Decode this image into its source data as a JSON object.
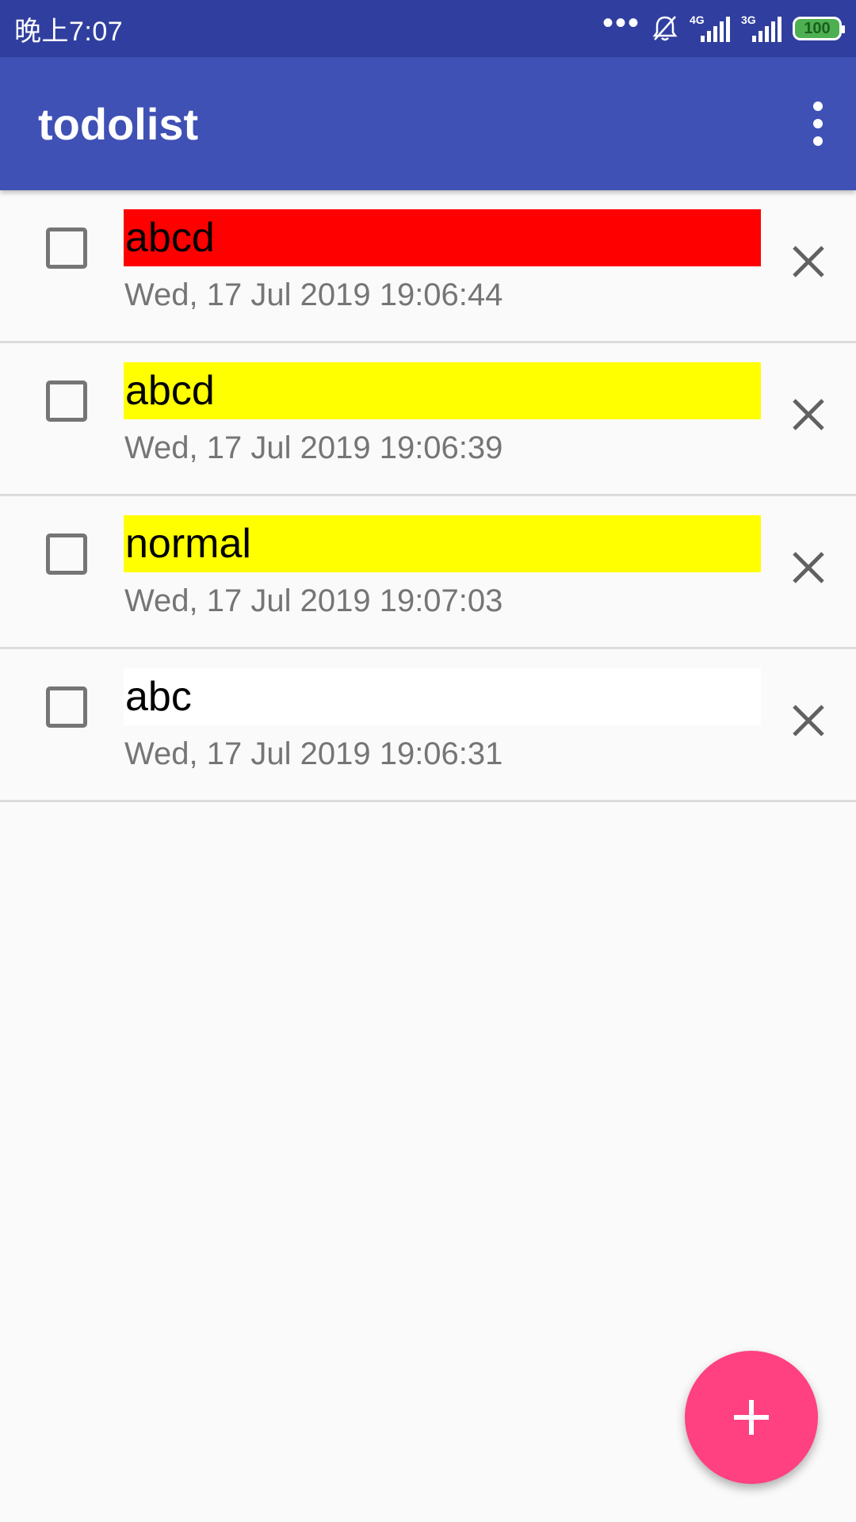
{
  "status_bar": {
    "time": "晚上7:07",
    "signal1_label": "4G",
    "signal2_label": "3G",
    "battery": "100",
    "icons": [
      "more-dots-icon",
      "bell-off-icon",
      "signal-icon",
      "battery-icon"
    ]
  },
  "app_bar": {
    "title": "todolist",
    "overflow_icon": "more-vert-icon"
  },
  "todos": [
    {
      "title": "abcd",
      "date": "Wed, 17 Jul 2019 19:06:44",
      "color": "#ff0000",
      "checked": false
    },
    {
      "title": "abcd",
      "date": "Wed, 17 Jul 2019 19:06:39",
      "color": "#ffff00",
      "checked": false
    },
    {
      "title": "normal",
      "date": "Wed, 17 Jul 2019 19:07:03",
      "color": "#ffff00",
      "checked": false
    },
    {
      "title": "abc",
      "date": "Wed, 17 Jul 2019 19:06:31",
      "color": "#ffffff",
      "checked": false
    }
  ],
  "colors": {
    "status_bar": "#303f9f",
    "app_bar": "#3f51b5",
    "fab": "#ff4081"
  },
  "fab": {
    "icon": "plus-icon"
  }
}
